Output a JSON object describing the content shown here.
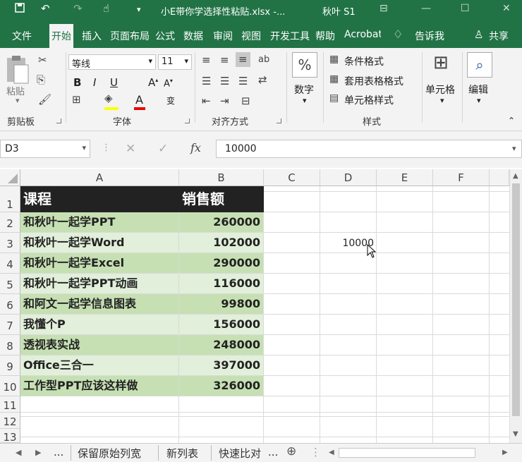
{
  "titlebar": {
    "filename": "小E带你学选择性粘贴.xlsx  -...",
    "user": "秋叶 S1"
  },
  "tabs": [
    "文件",
    "开始",
    "插入",
    "页面布局",
    "公式",
    "数据",
    "审阅",
    "视图",
    "开发工具",
    "帮助",
    "Acrobat"
  ],
  "active_tab": "开始",
  "tell_me": "告诉我",
  "share": "共享",
  "ribbon": {
    "clipboard": {
      "paste": "粘贴",
      "label": "剪贴板"
    },
    "font": {
      "name": "等线",
      "size": "11",
      "label": "字体"
    },
    "alignment": {
      "label": "对齐方式"
    },
    "number": {
      "btn": "数字"
    },
    "styles": {
      "cond": "条件格式",
      "table": "套用表格格式",
      "cell": "单元格样式",
      "label": "样式"
    },
    "cells": {
      "btn": "单元格"
    },
    "editing": {
      "btn": "编辑"
    }
  },
  "formula_bar": {
    "name_box": "D3",
    "fx": "fx",
    "value": "10000"
  },
  "columns": [
    "A",
    "B",
    "C",
    "D",
    "E",
    "F"
  ],
  "rows": [
    "1",
    "2",
    "3",
    "4",
    "5",
    "6",
    "7",
    "8",
    "9",
    "10",
    "11",
    "12",
    "13"
  ],
  "table": {
    "header": [
      "课程",
      "销售额"
    ],
    "data": [
      [
        "和秋叶一起学PPT",
        "260000"
      ],
      [
        "和秋叶一起学Word",
        "102000"
      ],
      [
        "和秋叶一起学Excel",
        "290000"
      ],
      [
        "和秋叶一起学PPT动画",
        "116000"
      ],
      [
        "和阿文一起学信息图表",
        "99800"
      ],
      [
        "我懂个P",
        "156000"
      ],
      [
        "透视表实战",
        "248000"
      ],
      [
        "Office三合一",
        "397000"
      ],
      [
        "工作型PPT应该这样做",
        "326000"
      ]
    ]
  },
  "d3_value": "10000",
  "sheet_tabs": [
    "...",
    "保留原始列宽",
    "新列表",
    "快速比对",
    "..."
  ],
  "colors": {
    "excel_green": "#217346",
    "row_dark": "#c6e0b4",
    "row_light": "#e2efda",
    "header": "#222222"
  }
}
